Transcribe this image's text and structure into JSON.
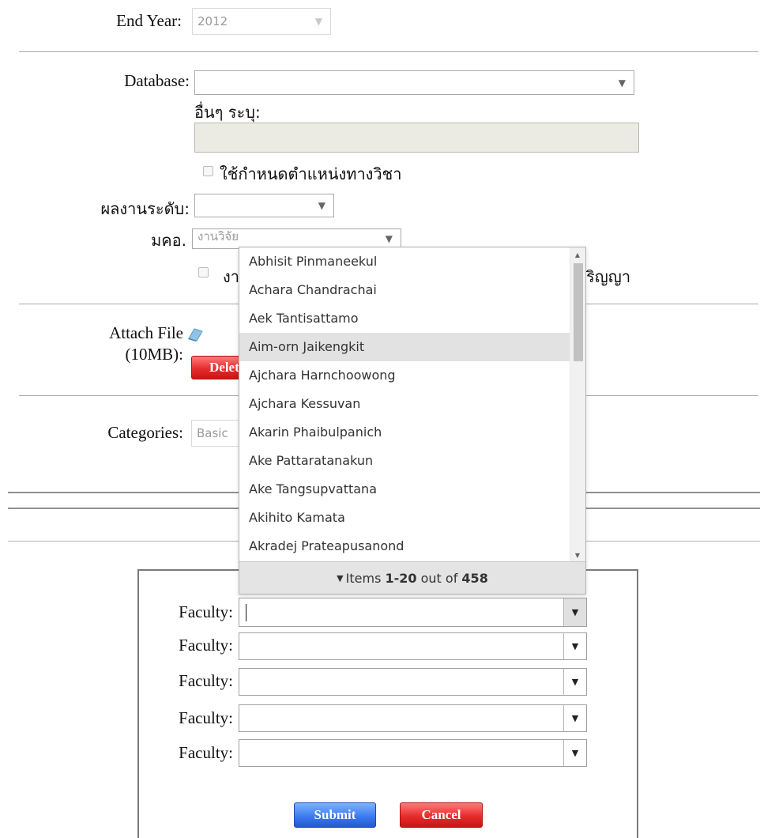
{
  "end_year": {
    "label": "End Year:",
    "value": "2012"
  },
  "database": {
    "label": "Database:",
    "value": ""
  },
  "other": {
    "label": "อื่นๆ ระบุ:",
    "value": ""
  },
  "academic_position": {
    "label": "ใช้กำหนดตำแหน่งทางวิชา"
  },
  "work_level": {
    "label": "ผลงานระดับ:",
    "value": ""
  },
  "tqf": {
    "label": "มคอ.",
    "value": "งานวิจัย"
  },
  "degree_checkbox": {
    "label_start": "งา",
    "label_end": "ริญญา"
  },
  "attach": {
    "label_line1": "Attach File",
    "label_line2": "(10MB):",
    "delete_label": "Delete"
  },
  "categories": {
    "label": "Categories:",
    "value": "Basic"
  },
  "faculty": {
    "label": "Faculty:",
    "rows": [
      "",
      "",
      "",
      "",
      ""
    ]
  },
  "dropdown": {
    "items": [
      "Abhisit Pinmaneekul",
      "Achara Chandrachai",
      "Aek Tantisattamo",
      "Aim-orn Jaikengkit",
      "Ajchara Harnchoowong",
      "Ajchara Kessuvan",
      "Akarin Phaibulpanich",
      "Ake Pattaratanakun",
      "Ake Tangsupvattana",
      "Akihito Kamata",
      "Akradej Prateapusanond"
    ],
    "highlighted_index": 3,
    "footer": {
      "prefix": "Items ",
      "range": "1-20",
      "middle": " out of ",
      "total": "458"
    }
  },
  "buttons": {
    "submit": "Submit",
    "cancel": "Cancel"
  }
}
